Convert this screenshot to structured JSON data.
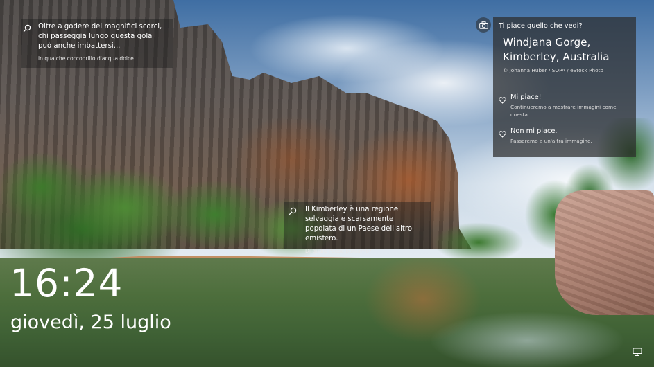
{
  "hints": [
    {
      "title": "Oltre a godere dei magnifici scorci, chi passeggia lungo questa gola può anche imbattersi...",
      "subtitle": "in qualche coccodrillo d'acqua dolce!"
    },
    {
      "title": "Il Kimberley è una regione selvaggia e scarsamente popolata di un Paese dell'altro emisfero.",
      "subtitle": "Di quale Paese parliamo?"
    }
  ],
  "panel": {
    "heading": "Ti piace quello che vedi?",
    "location": "Windjana Gorge, Kimberley, Australia",
    "credit": "© Johanna Huber / SOPA / eStock Photo",
    "like_label": "Mi piace!",
    "like_desc": "Continueremo a mostrare immagini come questa.",
    "dislike_label": "Non mi piace.",
    "dislike_desc": "Passeremo a un'altra immagine."
  },
  "lock": {
    "time": "16:24",
    "date": "giovedì, 25 luglio"
  },
  "icons": {
    "hint": "search-icon",
    "camera": "camera-icon",
    "like": "heart-icon",
    "network": "network-icon"
  }
}
